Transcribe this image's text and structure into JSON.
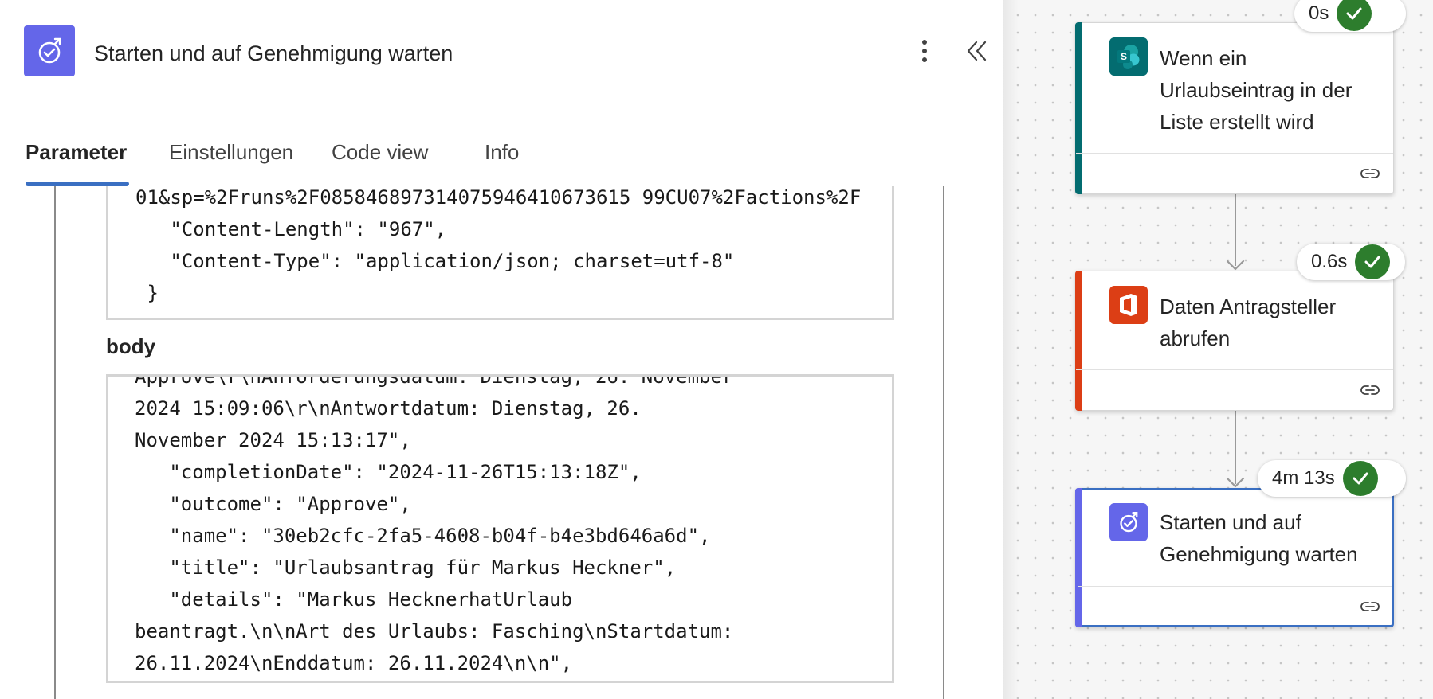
{
  "panel": {
    "title": "Starten und auf Genehmigung warten",
    "icon": "approval-icon",
    "tabs": [
      {
        "label": "Parameter",
        "active": true
      },
      {
        "label": "Einstellungen",
        "active": false
      },
      {
        "label": "Code view",
        "active": false
      },
      {
        "label": "Info",
        "active": false
      }
    ],
    "headers_code": "01&sp=%2Fruns%2F085846897314075946410673615 99CU07%2Factions%2F\n   \"Content-Length\": \"967\",\n   \"Content-Type\": \"application/json; charset=utf-8\"\n }",
    "body_label": "body",
    "body_code": "Approve\\r\\nAnforderungsdatum: Dienstag, 26. November\n2024 15:09:06\\r\\nAntwortdatum: Dienstag, 26.\nNovember 2024 15:13:17\",\n   \"completionDate\": \"2024-11-26T15:13:18Z\",\n   \"outcome\": \"Approve\",\n   \"name\": \"30eb2cfc-2fa5-4608-b04f-b4e3bd646a6d\",\n   \"title\": \"Urlaubsantrag für Markus Heckner\",\n   \"details\": \"Markus HecknerhatUrlaub\nbeantragt.\\n\\nArt des Urlaubs: Fasching\\nStartdatum:\n26.11.2024\\nEnddatum: 26.11.2024\\n\\n\","
  },
  "flow": {
    "steps": [
      {
        "title": "Wenn ein Urlaubseintrag in der Liste erstellt wird",
        "duration": "0s",
        "icon": "sharepoint-icon",
        "accent": "#036c70",
        "status": "succeeded"
      },
      {
        "title": "Daten Antragsteller abrufen",
        "duration": "0.6s",
        "icon": "office-icon",
        "accent": "#dc3e15",
        "status": "succeeded"
      },
      {
        "title": "Starten und auf Genehmigung warten",
        "duration": "4m 13s",
        "icon": "approval-icon",
        "accent": "#6466e9",
        "status": "succeeded"
      }
    ]
  },
  "colors": {
    "selected_border": "#3a6fc2",
    "success": "#2d7d2d",
    "tab_underline": "#3a6fc2"
  }
}
